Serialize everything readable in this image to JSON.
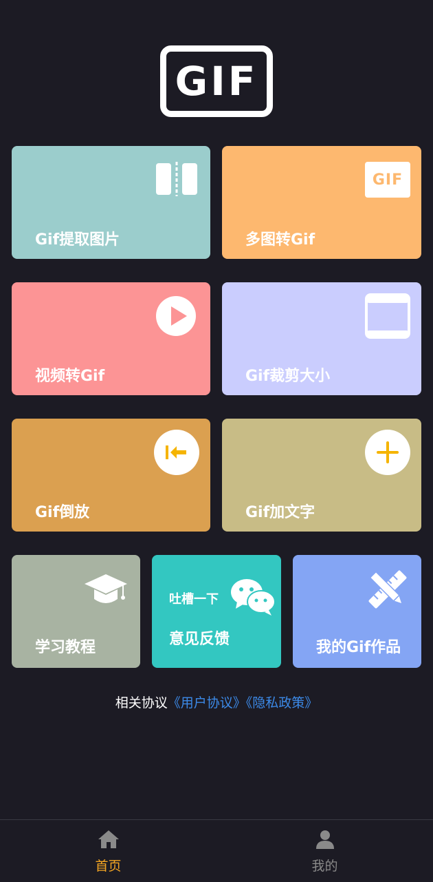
{
  "logo": {
    "text": "GIF"
  },
  "cards": {
    "extract": {
      "label": "Gif提取图片",
      "icon": "split-frames-icon"
    },
    "multi": {
      "label": "多图转Gif",
      "icon": "gif-badge-icon",
      "badge": "GIF"
    },
    "video": {
      "label": "视频转Gif",
      "icon": "play-icon"
    },
    "crop": {
      "label": "Gif裁剪大小",
      "icon": "crop-frame-icon"
    },
    "reverse": {
      "label": "Gif倒放",
      "icon": "rewind-icon"
    },
    "text": {
      "label": "Gif加文字",
      "icon": "plus-icon"
    },
    "tutorial": {
      "label": "学习教程",
      "icon": "graduation-cap-icon"
    },
    "feedback": {
      "label": "意见反馈",
      "sublabel": "吐槽一下",
      "icon": "wechat-icon"
    },
    "works": {
      "label": "我的Gif作品",
      "icon": "pencil-ruler-icon"
    }
  },
  "agreement": {
    "prefix": "相关协议",
    "user": "《用户协议》",
    "privacy": "《隐私政策》"
  },
  "tabbar": {
    "home": {
      "label": "首页",
      "icon": "home-icon",
      "color": "#f5a623"
    },
    "mine": {
      "label": "我的",
      "icon": "user-icon",
      "color": "#8a8a8a"
    }
  },
  "colors": {
    "background": "#1c1b24",
    "link": "#3c8ae8"
  }
}
